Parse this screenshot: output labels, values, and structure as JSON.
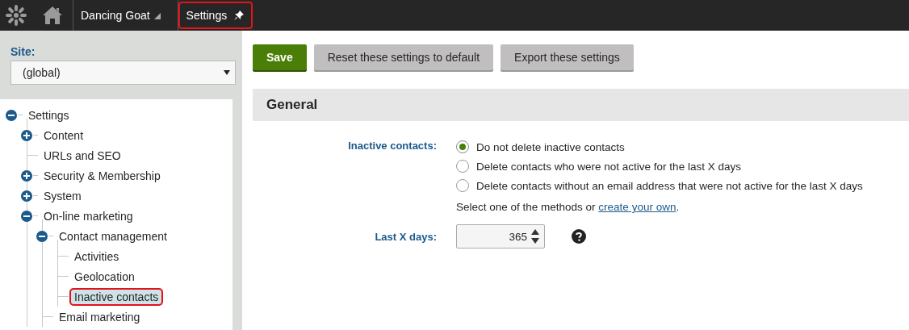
{
  "topbar": {
    "app_menu": "Dancing Goat",
    "tab": {
      "label": "Settings",
      "highlighted": true
    }
  },
  "sidebar": {
    "site_label": "Site:",
    "site_select": "(global)",
    "tree": [
      {
        "label": "Settings",
        "expanded": true,
        "selected": false,
        "children": [
          {
            "label": "Content",
            "expanded": false,
            "selected": false
          },
          {
            "label": "URLs and SEO",
            "selected": false
          },
          {
            "label": "Security & Membership",
            "expanded": false,
            "selected": false
          },
          {
            "label": "System",
            "expanded": false,
            "selected": false
          },
          {
            "label": "On-line marketing",
            "expanded": true,
            "selected": false,
            "children": [
              {
                "label": "Contact management",
                "expanded": true,
                "selected": false,
                "children": [
                  {
                    "label": "Activities",
                    "selected": false
                  },
                  {
                    "label": "Geolocation",
                    "selected": false
                  },
                  {
                    "label": "Inactive contacts",
                    "selected": true
                  }
                ]
              },
              {
                "label": "Email marketing",
                "selected": false
              }
            ]
          }
        ]
      }
    ]
  },
  "toolbar": {
    "buttons": [
      {
        "label": "Save",
        "kind": "primary"
      },
      {
        "label": "Reset these settings to default",
        "kind": "secondary"
      },
      {
        "label": "Export these settings",
        "kind": "secondary"
      }
    ]
  },
  "section": {
    "title": "General",
    "fields": [
      {
        "kind": "radio",
        "label": "Inactive contacts:",
        "options": [
          {
            "label": "Do not delete inactive contacts",
            "selected": true
          },
          {
            "label": "Delete contacts who were not active for the last X days",
            "selected": false
          },
          {
            "label": "Delete contacts without an email address that were not active for the last X days",
            "selected": false
          }
        ],
        "hint": "Select one of the methods or ",
        "hint_link": "create your own",
        "hint_end": "."
      },
      {
        "kind": "number",
        "label": "Last X days:",
        "value": "365"
      }
    ]
  }
}
